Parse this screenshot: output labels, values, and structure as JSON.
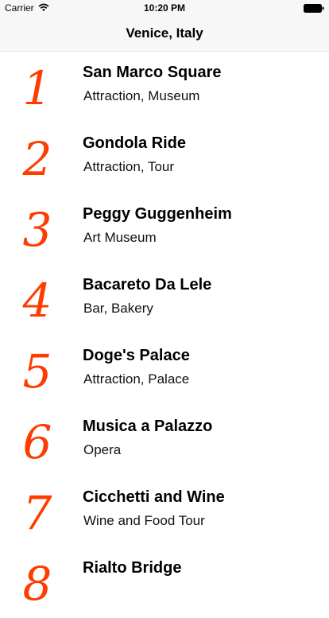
{
  "status_bar": {
    "carrier": "Carrier",
    "time": "10:20 PM",
    "icons": [
      "wifi-icon",
      "battery-icon"
    ]
  },
  "nav": {
    "title": "Venice, Italy"
  },
  "colors": {
    "rank": "#ff3c00",
    "bar_background": "#f7f7f7"
  },
  "places": [
    {
      "rank": "1",
      "name": "San Marco Square",
      "category": "Attraction, Museum"
    },
    {
      "rank": "2",
      "name": "Gondola Ride",
      "category": "Attraction, Tour"
    },
    {
      "rank": "3",
      "name": "Peggy Guggenheim",
      "category": "Art Museum"
    },
    {
      "rank": "4",
      "name": "Bacareto Da Lele",
      "category": "Bar, Bakery"
    },
    {
      "rank": "5",
      "name": "Doge's Palace",
      "category": "Attraction, Palace"
    },
    {
      "rank": "6",
      "name": "Musica a Palazzo",
      "category": "Opera"
    },
    {
      "rank": "7",
      "name": "Cicchetti and Wine",
      "category": "Wine and Food Tour"
    },
    {
      "rank": "8",
      "name": "Rialto Bridge",
      "category": ""
    }
  ]
}
